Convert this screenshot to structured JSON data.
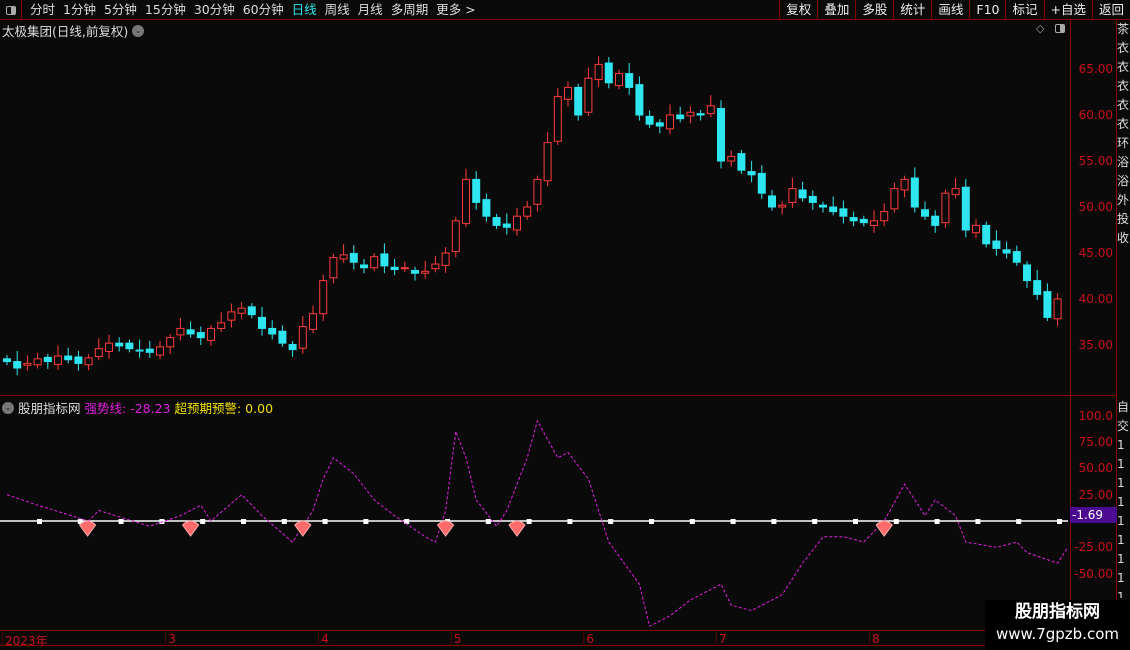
{
  "toolbar": {
    "periods": [
      "分时",
      "1分钟",
      "5分钟",
      "15分钟",
      "30分钟",
      "60分钟",
      "日线",
      "周线",
      "月线",
      "多周期",
      "更多 >"
    ],
    "active_period": "日线",
    "tools": [
      "复权",
      "叠加",
      "多股",
      "统计",
      "画线",
      "F10",
      "标记",
      "+自选",
      "返回"
    ]
  },
  "stock": {
    "title": "太极集团(日线,前复权)"
  },
  "price_axis": {
    "labels": [
      "65.00",
      "60.00",
      "55.00",
      "50.00",
      "45.00",
      "40.00",
      "35.00"
    ],
    "values": [
      65,
      60,
      55,
      50,
      45,
      40,
      35
    ]
  },
  "indicator": {
    "name": "股朋指标网",
    "line1_label": "强势线: -28.23",
    "line2_label": "超预期预警: 0.00",
    "current_value": "-1.69",
    "axis_labels": [
      "100.0",
      "75.00",
      "50.00",
      "25.00",
      "-25.00",
      "-50.00"
    ],
    "axis_values": [
      100,
      75,
      50,
      25,
      -25,
      -50
    ],
    "colors": {
      "line": "#e020e0",
      "label1": "#e020e0",
      "label2": "#f0e000"
    }
  },
  "x_axis": {
    "labels": [
      {
        "text": "2023年",
        "index": 0
      },
      {
        "text": "3",
        "index": 16
      },
      {
        "text": "4",
        "index": 31
      },
      {
        "text": "5",
        "index": 44
      },
      {
        "text": "6",
        "index": 57
      },
      {
        "text": "7",
        "index": 70
      },
      {
        "text": "8",
        "index": 85
      }
    ]
  },
  "right_panel": {
    "chars": "茶衣衣衣衣衣环浴浴外投收",
    "chars2": "自交1111111111"
  },
  "watermark": {
    "line1": "股朋指标网",
    "line2": "www.7gpzb.com"
  },
  "chart_data": {
    "type": "candlestick",
    "closes": [
      33.2,
      32.5,
      33,
      33.5,
      33.2,
      33.8,
      33.4,
      33,
      33.6,
      34.6,
      35.2,
      34.9,
      34.6,
      34.4,
      34.2,
      34.8,
      35.8,
      36.8,
      36.2,
      35.8,
      36.8,
      37.4,
      38.6,
      39,
      38.3,
      36.8,
      36.2,
      35.2,
      34.5,
      37,
      38.4,
      42,
      44.5,
      44.8,
      44,
      43.4,
      44.6,
      43.6,
      43.2,
      43.4,
      42.8,
      43,
      43.8,
      45,
      48.5,
      53,
      50.5,
      49,
      48,
      47.8,
      49,
      50,
      53,
      57,
      62,
      63,
      60,
      64,
      65.5,
      63.5,
      64.5,
      63,
      60,
      59,
      58.8,
      60,
      59.6,
      60.3,
      60,
      61,
      55,
      55.5,
      54,
      53.5,
      51.5,
      50,
      50.2,
      52,
      51,
      50.5,
      50,
      49.5,
      49,
      48.5,
      48.3,
      48.5,
      49.5,
      52,
      53,
      50,
      49,
      48,
      51.5,
      52,
      47.5,
      48,
      46,
      45.5,
      45,
      44,
      42,
      40.5,
      38,
      40
    ],
    "indicator_series": [
      [
        0,
        25
      ],
      [
        3,
        15
      ],
      [
        8,
        0
      ],
      [
        9,
        10
      ],
      [
        14,
        -5
      ],
      [
        17,
        5
      ],
      [
        19,
        15
      ],
      [
        20,
        0
      ],
      [
        23,
        25
      ],
      [
        25,
        5
      ],
      [
        28,
        -20
      ],
      [
        30,
        10
      ],
      [
        31,
        40
      ],
      [
        32,
        60
      ],
      [
        34,
        45
      ],
      [
        36,
        20
      ],
      [
        38,
        5
      ],
      [
        41,
        -15
      ],
      [
        42,
        -20
      ],
      [
        43,
        10
      ],
      [
        44,
        85
      ],
      [
        45,
        60
      ],
      [
        46,
        20
      ],
      [
        48,
        -5
      ],
      [
        49,
        10
      ],
      [
        51,
        60
      ],
      [
        52,
        95
      ],
      [
        54,
        60
      ],
      [
        55,
        65
      ],
      [
        57,
        40
      ],
      [
        59,
        -20
      ],
      [
        62,
        -60
      ],
      [
        63,
        -100
      ],
      [
        65,
        -90
      ],
      [
        67,
        -75
      ],
      [
        70,
        -60
      ],
      [
        71,
        -80
      ],
      [
        73,
        -85
      ],
      [
        75,
        -75
      ],
      [
        76,
        -70
      ],
      [
        78,
        -40
      ],
      [
        80,
        -15
      ],
      [
        82,
        -15
      ],
      [
        84,
        -20
      ],
      [
        86,
        0
      ],
      [
        88,
        35
      ],
      [
        90,
        5
      ],
      [
        91,
        20
      ],
      [
        93,
        5
      ],
      [
        94,
        -20
      ],
      [
        97,
        -25
      ],
      [
        99,
        -20
      ],
      [
        100,
        -30
      ],
      [
        103,
        -40
      ],
      [
        104,
        -25
      ]
    ],
    "signal_indices": [
      8,
      18,
      29,
      43,
      50,
      86
    ],
    "zero_marker_every": 4,
    "price_range": [
      31,
      69
    ],
    "indicator_range": [
      -105,
      110
    ]
  }
}
